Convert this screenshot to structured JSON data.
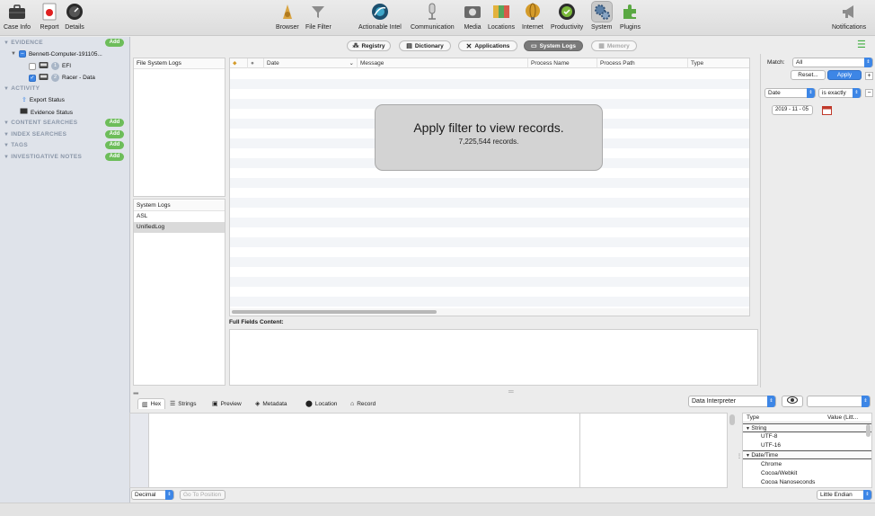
{
  "toolbar": {
    "left": [
      {
        "label": "Case Info",
        "icon": "briefcase-icon"
      },
      {
        "label": "Report",
        "icon": "report-icon"
      },
      {
        "label": "Details",
        "icon": "gauge-icon"
      }
    ],
    "center": [
      {
        "label": "Browser",
        "icon": "browser-icon"
      },
      {
        "label": "File Filter",
        "icon": "funnel-icon"
      },
      {
        "label": "Actionable Intel",
        "icon": "globe-icon"
      },
      {
        "label": "Communication",
        "icon": "microphone-icon"
      },
      {
        "label": "Media",
        "icon": "media-icon"
      },
      {
        "label": "Locations",
        "icon": "map-icon"
      },
      {
        "label": "Internet",
        "icon": "internet-globe-icon"
      },
      {
        "label": "Productivity",
        "icon": "productivity-icon"
      },
      {
        "label": "System",
        "icon": "gears-icon",
        "selected": true
      },
      {
        "label": "Plugins",
        "icon": "puzzle-icon"
      }
    ],
    "right": {
      "label": "Notifications",
      "icon": "megaphone-icon"
    }
  },
  "sidebar": {
    "evidence_label": "EVIDENCE",
    "add_label": "Add",
    "computer": "Bennett-Computer-191105...",
    "efi": "EFI",
    "efi_badge": "1",
    "racer": "Racer - Data",
    "racer_badge": "2",
    "activity_label": "ACTIVITY",
    "export_status": "Export Status",
    "evidence_status": "Evidence Status",
    "content_searches": "CONTENT SEARCHES",
    "index_searches": "INDEX SEARCHES",
    "tags": "TAGS",
    "investigative_notes": "INVESTIGATIVE NOTES"
  },
  "segments": [
    {
      "label": "Registry",
      "icon": "registry-icon"
    },
    {
      "label": "Dictionary",
      "icon": "dictionary-icon"
    },
    {
      "label": "Applications",
      "icon": "applications-icon"
    },
    {
      "label": "System Logs",
      "icon": "system-logs-icon",
      "selected": true
    },
    {
      "label": "Memory",
      "icon": "memory-icon",
      "disabled": true
    }
  ],
  "left_pane": {
    "header": "File System Logs",
    "system_logs_header": "System Logs",
    "items": [
      "ASL",
      "UnifiedLog"
    ]
  },
  "table": {
    "columns": [
      "Date",
      "Message",
      "Process Name",
      "Process Path",
      "Type"
    ]
  },
  "overlay": {
    "title": "Apply filter to view records.",
    "count": "7,225,544 records."
  },
  "full_fields": "Full Fields Content:",
  "filter": {
    "match_label": "Match:",
    "match_value": "All",
    "reset": "Reset...",
    "apply": "Apply",
    "field": "Date",
    "operator": "is exactly",
    "date_value": "2019 - 11 - 05"
  },
  "bottom": {
    "tabs": [
      "Hex",
      "Strings",
      "Preview",
      "Metadata",
      "Location",
      "Record"
    ],
    "interpreter": "Data Interpreter",
    "type_header": "Type",
    "value_header": "Value (Litt...",
    "rows": [
      {
        "text": "String",
        "group": true
      },
      {
        "text": "UTF-8",
        "group": false
      },
      {
        "text": "UTF-16",
        "group": false
      },
      {
        "text": "Date/Time",
        "group": true
      },
      {
        "text": "Chrome",
        "group": false
      },
      {
        "text": "Cocoa/Webkit",
        "group": false
      },
      {
        "text": "Cocoa Nanoseconds",
        "group": false
      }
    ],
    "decimal": "Decimal",
    "go_to_position": "Go To Position",
    "endian": "Little Endian"
  }
}
